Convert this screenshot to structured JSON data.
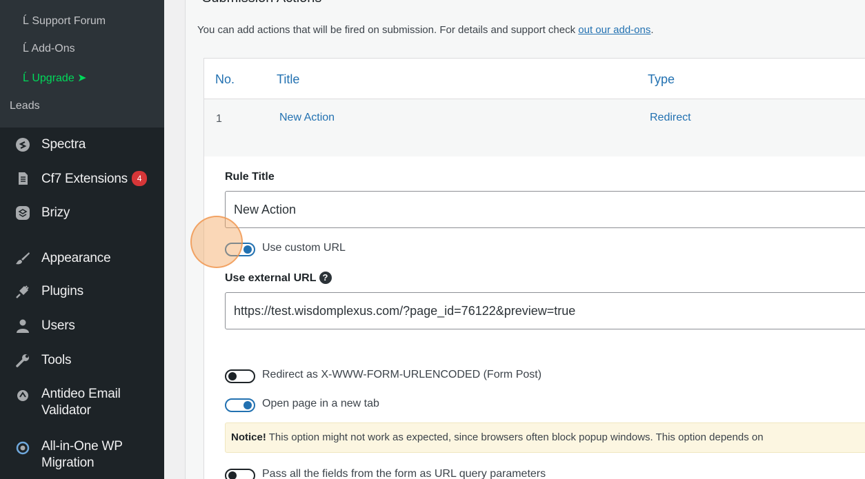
{
  "sidebar": {
    "submenu": [
      {
        "label": "└ Support Forum",
        "display": "Ĺ Support Forum"
      },
      {
        "label": "└ Add-Ons"
      },
      {
        "label": "└ Upgrade ➤"
      },
      {
        "label": "Leads"
      }
    ],
    "sub_support": "࿗ Support Forum",
    "items": [
      {
        "label": "Spectra",
        "icon": "spectra-icon"
      },
      {
        "label": "Cf7 Extensions",
        "icon": "document-icon",
        "badge": "4"
      },
      {
        "label": "Brizy",
        "icon": "brizy-icon"
      },
      {
        "label": "Appearance",
        "icon": "paintbrush-icon"
      },
      {
        "label": "Plugins",
        "icon": "plugin-icon"
      },
      {
        "label": "Users",
        "icon": "users-icon"
      },
      {
        "label": "Tools",
        "icon": "wrench-icon"
      },
      {
        "label": "Antideo Email Validator",
        "icon": "antideo-icon"
      },
      {
        "label": "All-in-One WP Migration",
        "icon": "migration-icon"
      }
    ],
    "labels": {
      "support": "Ĺ Support Forum",
      "addons": "Ĺ Add-Ons",
      "upgrade": "Ĺ Upgrade ➤",
      "leads": "Leads",
      "antideo_1": "Antideo Email",
      "antideo_2": "Validator",
      "migration_1": "All-in-One WP",
      "migration_2": "Migration"
    }
  },
  "main": {
    "section_title": "Submission Actions",
    "description": "You can add actions that will be fired on submission. For details and support check ",
    "description_link": "out our add-ons",
    "description_end": ".",
    "table": {
      "headers": [
        "No.",
        "Title",
        "Type"
      ],
      "rows": [
        {
          "no": "1",
          "title": "New Action",
          "type": "Redirect"
        }
      ]
    },
    "form": {
      "rule_title_label": "Rule Title",
      "rule_title_value": "New Action",
      "use_custom_url_label": "Use custom URL",
      "external_url_label": "Use external URL",
      "external_url_value": "https://test.wisdomplexus.com/?page_id=76122&preview=true",
      "redirect_form_post_label": "Redirect as X-WWW-FORM-URLENCODED (Form Post)",
      "new_tab_label": "Open page in a new tab",
      "notice_bold": "Notice!",
      "notice_text": " This option might not work as expected, since browsers often block popup windows. This option depends on",
      "pass_fields_label": "Pass all the fields from the form as URL query parameters"
    }
  },
  "colors": {
    "sidebar_bg": "#1d2327",
    "submenu_bg": "#2c3338",
    "accent": "#2271b1",
    "upgrade": "#00d95a",
    "badge": "#d63638"
  }
}
